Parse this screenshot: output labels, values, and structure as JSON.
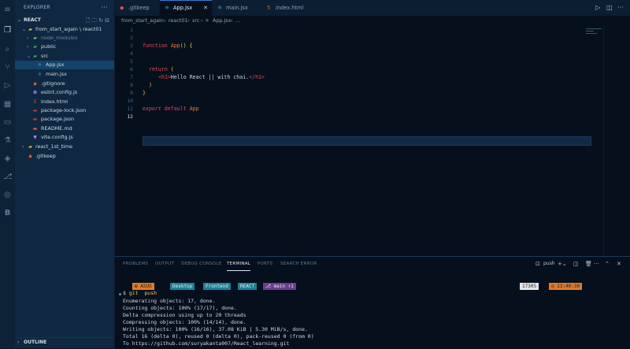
{
  "activity_bar": {
    "icons": [
      "files-icon",
      "search-icon",
      "source-control-icon",
      "run-debug-icon",
      "extensions-icon",
      "remote-icon",
      "testing-icon",
      "docker-icon",
      "git-graph-icon",
      "database-icon",
      "live-share-icon",
      "settings-b-icon"
    ]
  },
  "sidebar": {
    "title": "EXPLORER",
    "more": "···",
    "section": "REACT",
    "tree": [
      {
        "label": "from_start_again \\ react01",
        "kind": "folder-open",
        "depth": 1
      },
      {
        "label": "node_modules",
        "kind": "folder",
        "depth": 2
      },
      {
        "label": "public",
        "kind": "folder",
        "depth": 2
      },
      {
        "label": "src",
        "kind": "folder-open",
        "depth": 2
      },
      {
        "label": "App.jsx",
        "kind": "react",
        "depth": 3,
        "selected": true
      },
      {
        "label": "main.jsx",
        "kind": "react",
        "depth": 3
      },
      {
        "label": ".gitignore",
        "kind": "git",
        "depth": 2
      },
      {
        "label": "eslint.config.js",
        "kind": "eslint",
        "depth": 2
      },
      {
        "label": "index.html",
        "kind": "html",
        "depth": 2
      },
      {
        "label": "package-lock.json",
        "kind": "json",
        "depth": 2
      },
      {
        "label": "package.json",
        "kind": "json",
        "depth": 2
      },
      {
        "label": "README.md",
        "kind": "md",
        "depth": 2
      },
      {
        "label": "vite.config.js",
        "kind": "vite",
        "depth": 2
      },
      {
        "label": "react_1st_time",
        "kind": "folder",
        "depth": 1
      },
      {
        "label": ".gitkeep",
        "kind": "git",
        "depth": 1
      }
    ],
    "outline": "OUTLINE"
  },
  "tabs": [
    {
      "label": ".gitkeep",
      "icon": "git-icon"
    },
    {
      "label": "App.jsx",
      "icon": "react-icon",
      "active": true
    },
    {
      "label": "main.jsx",
      "icon": "react-icon"
    },
    {
      "label": "index.html",
      "icon": "html-icon"
    }
  ],
  "breadcrumb": [
    "from_start_again",
    "react01",
    "src",
    "App.jsx",
    "..."
  ],
  "editor": {
    "lines": [
      "1",
      "2",
      "3",
      "4",
      "5",
      "6",
      "7",
      "8",
      "9",
      "10",
      "11",
      "12"
    ],
    "current_line": "12",
    "code": {
      "l3_kw": "function ",
      "l3_fn": "App",
      "l3_paren": "() ",
      "l3_brace": "{",
      "l6_kw": "return ",
      "l6_paren": "(",
      "l7_open": "<h1>",
      "l7_text": "Hello React || with chai.",
      "l7_close": "</h1>",
      "l8_paren": ")",
      "l9_brace": "}",
      "l11_kw1": "export ",
      "l11_kw2": "default ",
      "l11_name": "App"
    }
  },
  "panel": {
    "tabs": [
      "PROBLEMS",
      "OUTPUT",
      "DEBUG CONSOLE",
      "TERMINAL",
      "PORTS",
      "SEARCH ERROR"
    ],
    "active_tab": "TERMINAL",
    "shell": "push",
    "prompt": {
      "segments": [
        "ASUS",
        "Desktop",
        "Frontend",
        "REACT",
        "main ↑1"
      ],
      "right_segments": [
        "17305",
        "23:40:30"
      ]
    },
    "terminal": [
      "$ git  push",
      "Enumerating objects: 17, done.",
      "Counting objects: 100% (17/17), done.",
      "Delta compression using up to 20 threads",
      "Compressing objects: 100% (14/14), done.",
      "Writing objects: 100% (16/16), 37.08 KiB | 5.30 MiB/s, done.",
      "Total 16 (delta 0), reused 0 (delta 0), pack-reused 0 (from 0)",
      "To https://github.com/suryakanta007/React_learning.git"
    ]
  },
  "colors": {
    "accent": "#2f7fd0",
    "keyword": "#e5485b",
    "function": "#e97b2e",
    "bracket": "#f0c44a",
    "git_branch_bg": "#6a3d8f",
    "prompt_os_bg": "#e07a2a",
    "prompt_path_bg": "#1f7f95"
  }
}
